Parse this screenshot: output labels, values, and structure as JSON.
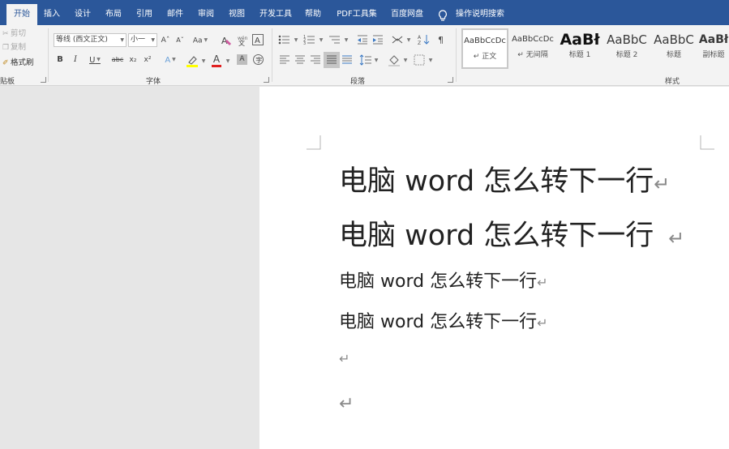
{
  "tabs": [
    {
      "label": "开始",
      "active": true
    },
    {
      "label": "插入"
    },
    {
      "label": "设计"
    },
    {
      "label": "布局"
    },
    {
      "label": "引用"
    },
    {
      "label": "邮件"
    },
    {
      "label": "审阅"
    },
    {
      "label": "视图"
    },
    {
      "label": "开发工具"
    },
    {
      "label": "帮助"
    },
    {
      "label": "PDF工具集"
    },
    {
      "label": "百度网盘"
    }
  ],
  "tell_me": "操作说明搜索",
  "clipboard": {
    "cut": "剪切",
    "copy": "复制",
    "format_painter": "格式刷",
    "group_label": "贴板"
  },
  "font": {
    "name": "等线 (西文正文)",
    "size": "小一",
    "group_label": "字体",
    "grow_label": "Aˆ",
    "shrink_label": "Aˇ",
    "change_case_label": "Aa",
    "bold": "B",
    "italic": "I",
    "underline": "U",
    "strike": "abc",
    "subscript": "x₂",
    "superscript": "x²",
    "text_effect": "A",
    "font_color": "A",
    "char_shading": "A",
    "highlight_color": "#ffff00",
    "font_color_value": "#e02020"
  },
  "paragraph": {
    "group_label": "段落"
  },
  "styles": {
    "group_label": "样式",
    "items": [
      {
        "preview": "AaBbCcDc",
        "name": "↵ 正文",
        "selected": true
      },
      {
        "preview": "AaBbCcDc",
        "name": "↵ 无间隔"
      },
      {
        "preview": "AaBł",
        "name": "标题 1"
      },
      {
        "preview": "AaBbC",
        "name": "标题 2"
      },
      {
        "preview": "AaBbC",
        "name": "标题"
      },
      {
        "preview": "AaBł",
        "name": "副标题"
      }
    ]
  },
  "document": {
    "lines": [
      {
        "text": "电脑 word 怎么转下一行",
        "mark": "↵"
      },
      {
        "text": "电脑 word 怎么转下一行",
        "mark": "↵"
      },
      {
        "text": "电脑 word 怎么转下一行",
        "mark": "↵"
      },
      {
        "text": "电脑 word 怎么转下一行",
        "mark": "↵"
      },
      {
        "text": "",
        "mark": "↵"
      },
      {
        "text": "",
        "mark": "↵"
      }
    ]
  },
  "colors": {
    "tab_bar": "#2b579a",
    "ribbon": "#f3f3f3",
    "canvas": "#e6e6e6",
    "page": "#ffffff"
  }
}
